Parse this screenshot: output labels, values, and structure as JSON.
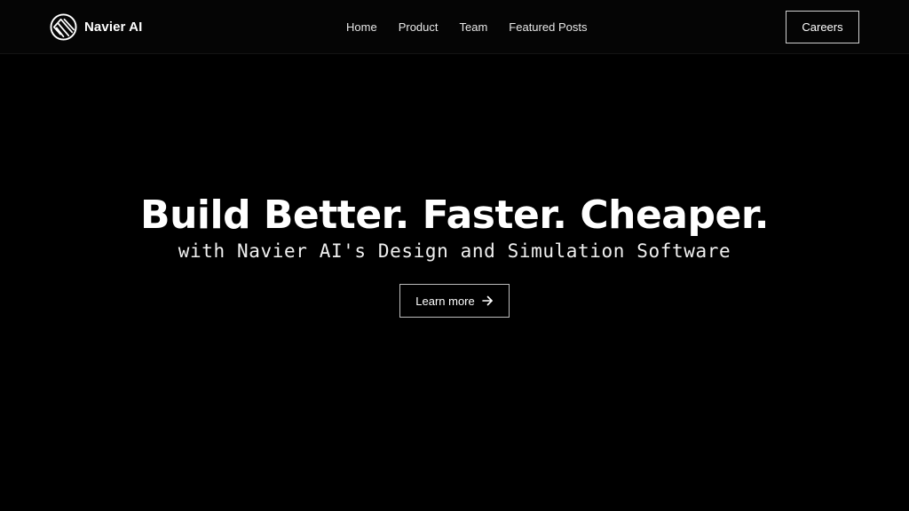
{
  "header": {
    "brand_name": "Navier AI",
    "logo_icon": "navier-logo-icon",
    "nav": [
      {
        "label": "Home"
      },
      {
        "label": "Product"
      },
      {
        "label": "Team"
      },
      {
        "label": "Featured Posts"
      }
    ],
    "careers_label": "Careers"
  },
  "hero": {
    "title": "Build Better. Faster. Cheaper.",
    "subtitle": "with Navier AI's Design and Simulation Software",
    "cta_label": "Learn more",
    "cta_icon": "arrow-right-icon"
  },
  "colors": {
    "background": "#000000",
    "text": "#ffffff",
    "border": "#d0d0d0"
  }
}
